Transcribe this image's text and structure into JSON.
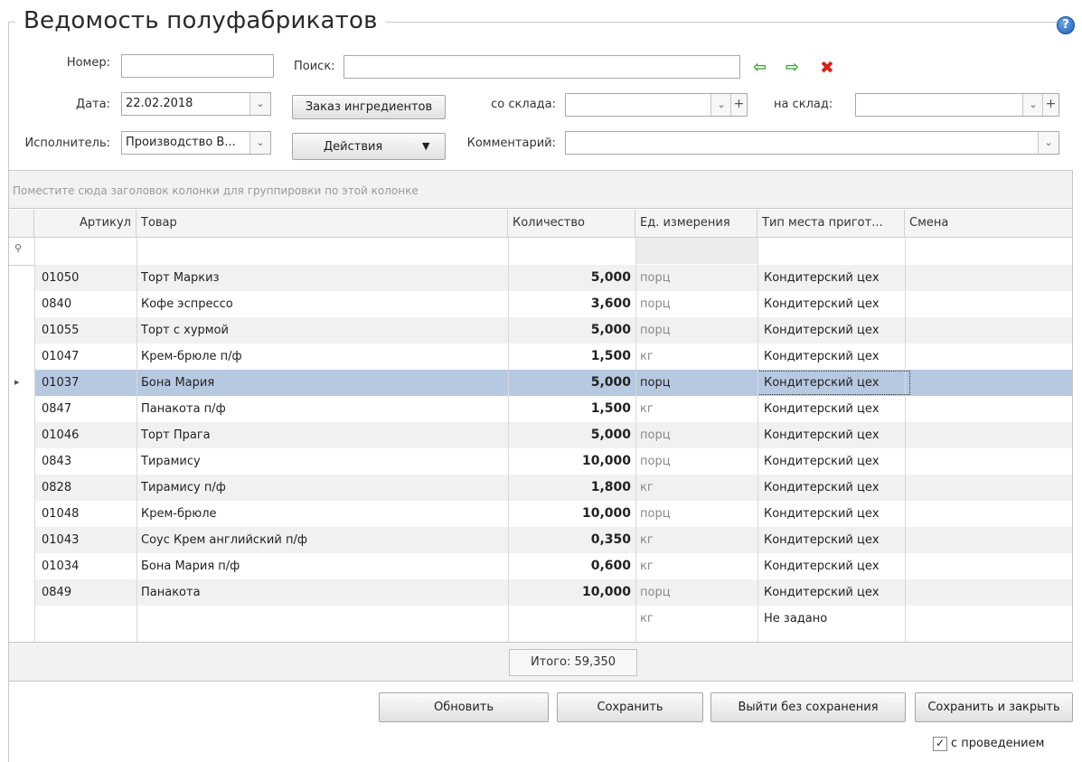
{
  "window": {
    "title": "Ведомость полуфабрикатов",
    "help_icon": "?"
  },
  "form": {
    "number_label": "Номер:",
    "number_value": "",
    "search_label": "Поиск:",
    "search_value": "",
    "date_label": "Дата:",
    "date_value": "22.02.2018",
    "order_button": "Заказ ингредиентов",
    "from_store_label": "со склада:",
    "from_store_value": "",
    "to_store_label": "на склад:",
    "to_store_value": "",
    "executor_label": "Исполнитель:",
    "executor_value": "Производство В...",
    "actions_button": "Действия",
    "comment_label": "Комментарий:",
    "comment_value": ""
  },
  "icons": {
    "prev": "⇦",
    "next": "⇨",
    "delete": "✖",
    "dropdown": "⌄",
    "plus": "+",
    "row_pointer": "▸",
    "filter": "⚲"
  },
  "grid": {
    "group_hint": "Поместите сюда заголовок колонки для группировки по этой колонке",
    "columns": [
      "Артикул",
      "Товар",
      "Количество",
      "Ед. измерения",
      "Тип места пригот...",
      "Смена"
    ],
    "rows": [
      {
        "article": "01050",
        "product": "Торт Маркиз",
        "qty": "5,000",
        "unit": "порц",
        "place": "Кондитерский цех",
        "shift": ""
      },
      {
        "article": "0840",
        "product": "Кофе эспрессо",
        "qty": "3,600",
        "unit": "порц",
        "place": "Кондитерский цех",
        "shift": ""
      },
      {
        "article": "01055",
        "product": "Торт с хурмой",
        "qty": "5,000",
        "unit": "порц",
        "place": "Кондитерский цех",
        "shift": ""
      },
      {
        "article": "01047",
        "product": "Крем-брюле п/ф",
        "qty": "1,500",
        "unit": "кг",
        "place": "Кондитерский цех",
        "shift": ""
      },
      {
        "article": "01037",
        "product": "Бона Мария",
        "qty": "5,000",
        "unit": "порц",
        "place": "Кондитерский цех",
        "shift": ""
      },
      {
        "article": "0847",
        "product": "Панакота п/ф",
        "qty": "1,500",
        "unit": "кг",
        "place": "Кондитерский цех",
        "shift": ""
      },
      {
        "article": "01046",
        "product": "Торт Прага",
        "qty": "5,000",
        "unit": "порц",
        "place": "Кондитерский цех",
        "shift": ""
      },
      {
        "article": "0843",
        "product": "Тирамису",
        "qty": "10,000",
        "unit": "порц",
        "place": "Кондитерский цех",
        "shift": ""
      },
      {
        "article": "0828",
        "product": "Тирамису п/ф",
        "qty": "1,800",
        "unit": "кг",
        "place": "Кондитерский цех",
        "shift": ""
      },
      {
        "article": "01048",
        "product": "Крем-брюле",
        "qty": "10,000",
        "unit": "порц",
        "place": "Кондитерский цех",
        "shift": ""
      },
      {
        "article": "01043",
        "product": "Соус Крем английский п/ф",
        "qty": "0,350",
        "unit": "кг",
        "place": "Кондитерский цех",
        "shift": ""
      },
      {
        "article": "01034",
        "product": "Бона Мария п/ф",
        "qty": "0,600",
        "unit": "кг",
        "place": "Кондитерский цех",
        "shift": ""
      },
      {
        "article": "0849",
        "product": "Панакота",
        "qty": "10,000",
        "unit": "порц",
        "place": "Кондитерский цех",
        "shift": ""
      },
      {
        "article": "",
        "product": "",
        "qty": "",
        "unit": "кг",
        "place": "Не задано",
        "shift": ""
      }
    ],
    "selected_row": 4,
    "total": "Итого: 59,350"
  },
  "footer": {
    "refresh": "Обновить",
    "save": "Сохранить",
    "exit_no_save": "Выйти без сохранения",
    "save_close": "Сохранить и закрыть",
    "posting_label": "с проведением",
    "posting_checked": true
  }
}
